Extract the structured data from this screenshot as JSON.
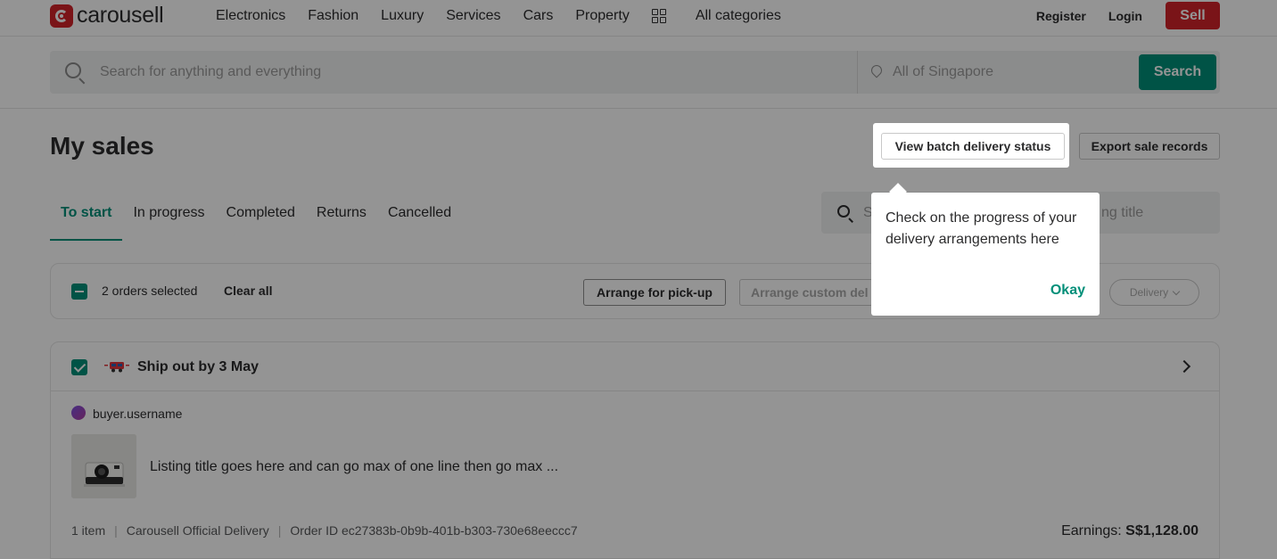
{
  "nav": {
    "logo_text": "carousell",
    "links": [
      "Electronics",
      "Fashion",
      "Luxury",
      "Services",
      "Cars",
      "Property"
    ],
    "all_categories": "All categories",
    "register": "Register",
    "login": "Login",
    "sell": "Sell"
  },
  "search": {
    "placeholder": "Search for anything and everything",
    "location_placeholder": "All of Singapore",
    "button": "Search"
  },
  "page": {
    "title": "My sales",
    "batch_button": "View batch delivery status",
    "export_button": "Export sale records",
    "tabs": [
      "To start",
      "In progress",
      "Completed",
      "Returns",
      "Cancelled"
    ],
    "active_tab": "To start",
    "listing_search_start": "S",
    "listing_search_end": "ng title"
  },
  "selection_bar": {
    "selected_text": "2 orders selected",
    "clear_all": "Clear all",
    "arrange_pickup": "Arrange for pick-up",
    "arrange_custom": "Arrange custom del",
    "delivery_filter": "Delivery"
  },
  "order": {
    "ship_by": "Ship out by 3 May",
    "buyer": "buyer.username",
    "listing_title": "Listing title goes here and can go max of one line then go max ...",
    "item_count": "1 item",
    "delivery_method": "Carousell Official Delivery",
    "order_id": "Order ID ec27383b-0b9b-401b-b303-730e68eeccc7",
    "earnings_label": "Earnings:",
    "earnings_value": "S$1,128.00"
  },
  "tooltip": {
    "text": "Check on the progress of your delivery arrangements here",
    "okay": "Okay"
  },
  "colors": {
    "brand_red": "#d2232a",
    "accent_green": "#008f79"
  }
}
